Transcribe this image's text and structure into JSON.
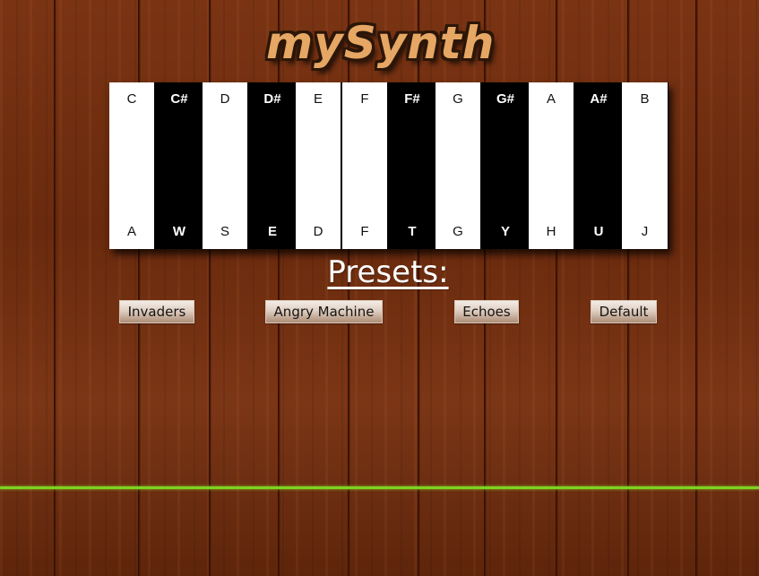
{
  "app": {
    "logo_text": "mySynth"
  },
  "keyboard": {
    "keys": [
      {
        "note": "C",
        "key": "A",
        "color": "white"
      },
      {
        "note": "C#",
        "key": "W",
        "color": "black"
      },
      {
        "note": "D",
        "key": "S",
        "color": "white"
      },
      {
        "note": "D#",
        "key": "E",
        "color": "black"
      },
      {
        "note": "E",
        "key": "D",
        "color": "white"
      },
      {
        "note": "F",
        "key": "F",
        "color": "white"
      },
      {
        "note": "F#",
        "key": "T",
        "color": "black"
      },
      {
        "note": "G",
        "key": "G",
        "color": "white"
      },
      {
        "note": "G#",
        "key": "Y",
        "color": "black"
      },
      {
        "note": "A",
        "key": "H",
        "color": "white"
      },
      {
        "note": "A#",
        "key": "U",
        "color": "black"
      },
      {
        "note": "B",
        "key": "J",
        "color": "white"
      }
    ]
  },
  "presets": {
    "title": "Presets:",
    "buttons": [
      "Invaders",
      "Angry Machine",
      "Echoes",
      "Default"
    ]
  },
  "colors": {
    "wood": "#6e2e0f",
    "logo": "#e6a764",
    "waveform": "#7ed321"
  }
}
